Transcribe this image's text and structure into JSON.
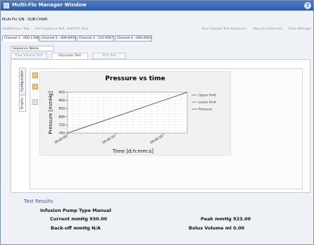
{
  "window": {
    "title": "Multi-Flo Manager Window",
    "help": "?"
  },
  "device": {
    "label": "Multi-Flo S/N : DUB-CHAM"
  },
  "toolbar": [
    "Add/Remove Test",
    "Add Sequence Test",
    "Add PCA Test",
    "Run Channel Test Sequence",
    "Stop ALL Channels",
    "Close Manager"
  ],
  "channels": [
    {
      "label": "Channel 1 : 000-1766",
      "active": true
    },
    {
      "label": "Channel 2 : 400-0001",
      "active": false
    },
    {
      "label": "Channel 3 : 122-9567",
      "active": false
    },
    {
      "label": "Channel 4 : 000-2003",
      "active": false
    }
  ],
  "sequence_name": "Sequence Name",
  "test_tabs": [
    {
      "label": "Flow Volume Test",
      "active": false
    },
    {
      "label": "Occlusion Test",
      "active": true
    },
    {
      "label": "PCA Test",
      "active": false
    }
  ],
  "side_tabs": {
    "configuration": "Configuration",
    "graphs": "Graphs"
  },
  "chart_data": {
    "type": "line",
    "title": "Pressure vs time",
    "xlabel": "Time [d:h:mm:s]",
    "ylabel": "Pressure [mmHg]",
    "ylim": [
      700,
      950
    ],
    "yticks": [
      950,
      900,
      850,
      800,
      750,
      700
    ],
    "xticks": [
      "00:00:00",
      "00:00:10",
      "00:00:20"
    ],
    "grid": true,
    "legend_position": "top-right",
    "series": [
      {
        "name": "Upper limit",
        "x": [],
        "y": [],
        "color": "#444444"
      },
      {
        "name": "Lower limit",
        "x": [],
        "y": [],
        "color": "#444444"
      },
      {
        "name": "Pressure",
        "x": [
          0,
          25
        ],
        "y": [
          700,
          950
        ],
        "color": "#333333"
      }
    ]
  },
  "results": {
    "title": "Test Results",
    "pump_type": "Infusion Pump Type Manual",
    "current": "Current mmHg 930.00",
    "peak": "Peak mmHg 923.00",
    "backoff": "Back-off mmHg N/A",
    "bolus": "Bolus Volume ml 0.00"
  }
}
